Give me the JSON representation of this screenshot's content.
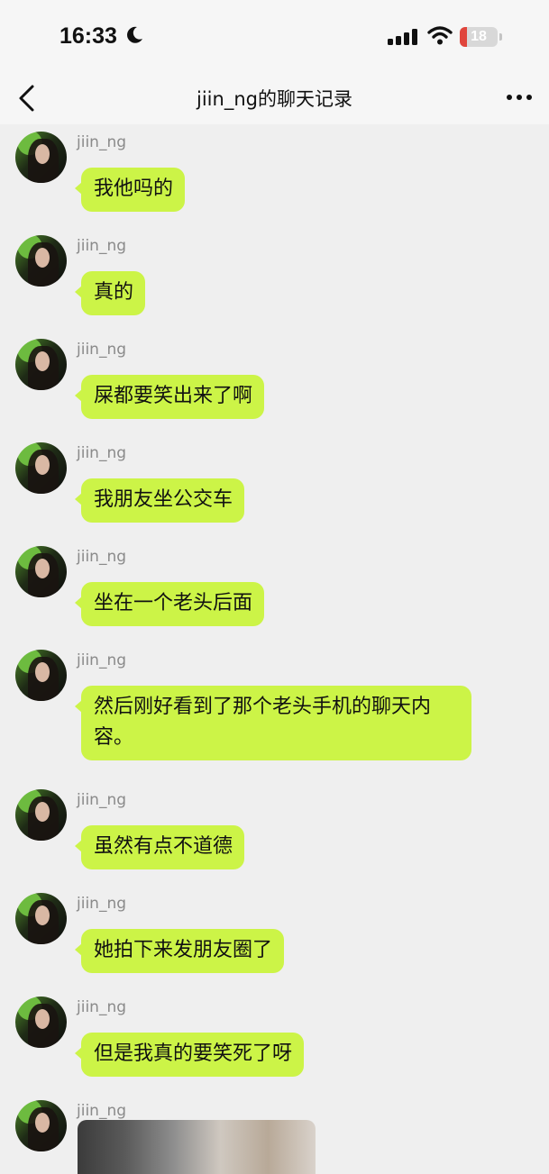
{
  "status_bar": {
    "time": "16:33",
    "moon_icon": "moon-icon",
    "signal_icon": "cellular-signal-icon",
    "wifi_icon": "wifi-icon",
    "battery_level": "18",
    "battery_fraction": 0.18,
    "battery_color": "#e0453c"
  },
  "nav": {
    "title": "jiin_ng的聊天记录",
    "back_icon": "chevron-left-icon",
    "more_icon": "more-dots-icon"
  },
  "colors": {
    "bubble": "#ccf447",
    "background": "#efefef"
  },
  "messages": [
    {
      "sender": "jiin_ng",
      "text": "我他吗的"
    },
    {
      "sender": "jiin_ng",
      "text": "真的"
    },
    {
      "sender": "jiin_ng",
      "text": "屎都要笑出来了啊"
    },
    {
      "sender": "jiin_ng",
      "text": "我朋友坐公交车"
    },
    {
      "sender": "jiin_ng",
      "text": "坐在一个老头后面"
    },
    {
      "sender": "jiin_ng",
      "text": "然后刚好看到了那个老头手机的聊天内容。"
    },
    {
      "sender": "jiin_ng",
      "text": "虽然有点不道德"
    },
    {
      "sender": "jiin_ng",
      "text": "她拍下来发朋友圈了"
    },
    {
      "sender": "jiin_ng",
      "text": "但是我真的要笑死了呀"
    },
    {
      "sender": "jiin_ng",
      "text": "",
      "type": "image"
    }
  ]
}
